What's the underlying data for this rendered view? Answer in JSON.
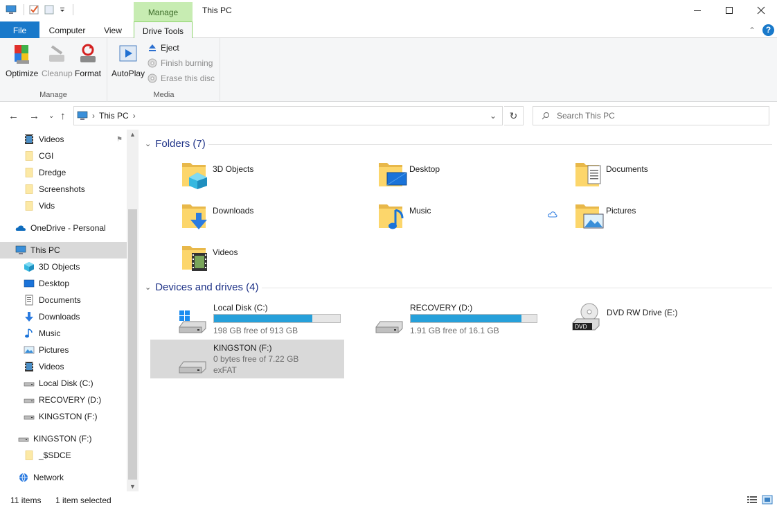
{
  "window": {
    "title": "This PC",
    "context_tab": "Manage"
  },
  "tabs": {
    "file": "File",
    "computer": "Computer",
    "view": "View",
    "drive_tools": "Drive Tools"
  },
  "ribbon": {
    "manage_group": {
      "label": "Manage",
      "optimize": "Optimize",
      "cleanup": "Cleanup",
      "format": "Format"
    },
    "media_group": {
      "label": "Media",
      "autoplay": "AutoPlay",
      "eject": "Eject",
      "finish_burning": "Finish burning",
      "erase_disc": "Erase this disc"
    }
  },
  "address": {
    "path": "This PC",
    "search_placeholder": "Search This PC"
  },
  "navpane": {
    "items": [
      {
        "label": "Videos",
        "icon": "videos-icon"
      },
      {
        "label": "CGI",
        "icon": "folder-icon"
      },
      {
        "label": "Dredge",
        "icon": "folder-icon"
      },
      {
        "label": "Screenshots",
        "icon": "folder-icon"
      },
      {
        "label": "Vids",
        "icon": "folder-icon"
      },
      {
        "label": "OneDrive - Personal",
        "icon": "onedrive-icon"
      },
      {
        "label": "This PC",
        "icon": "this-pc-icon"
      },
      {
        "label": "3D Objects",
        "icon": "3d-objects-icon"
      },
      {
        "label": "Desktop",
        "icon": "desktop-icon"
      },
      {
        "label": "Documents",
        "icon": "documents-icon"
      },
      {
        "label": "Downloads",
        "icon": "downloads-icon"
      },
      {
        "label": "Music",
        "icon": "music-icon"
      },
      {
        "label": "Pictures",
        "icon": "pictures-icon"
      },
      {
        "label": "Videos",
        "icon": "videos-icon"
      },
      {
        "label": "Local Disk (C:)",
        "icon": "drive-icon"
      },
      {
        "label": "RECOVERY (D:)",
        "icon": "drive-icon"
      },
      {
        "label": "KINGSTON (F:)",
        "icon": "drive-icon"
      },
      {
        "label": "KINGSTON (F:)",
        "icon": "drive-icon"
      },
      {
        "label": "_$SDCE",
        "icon": "folder-icon"
      },
      {
        "label": "Network",
        "icon": "network-icon"
      }
    ]
  },
  "content": {
    "folders_header": "Folders (7)",
    "folders": [
      {
        "name": "3D Objects",
        "icon": "3d-objects-icon"
      },
      {
        "name": "Desktop",
        "icon": "desktop-icon"
      },
      {
        "name": "Documents",
        "icon": "documents-icon"
      },
      {
        "name": "Downloads",
        "icon": "downloads-icon"
      },
      {
        "name": "Music",
        "icon": "music-icon"
      },
      {
        "name": "Pictures",
        "icon": "pictures-icon"
      },
      {
        "name": "Videos",
        "icon": "videos-icon"
      }
    ],
    "devices_header": "Devices and drives (4)",
    "drives": [
      {
        "name": "Local Disk (C:)",
        "free": "198 GB free of 913 GB",
        "used_fraction": 0.78
      },
      {
        "name": "RECOVERY (D:)",
        "free": "1.91 GB free of 16.1 GB",
        "used_fraction": 0.88
      },
      {
        "name": "DVD RW Drive (E:)"
      },
      {
        "name": "KINGSTON (F:)",
        "free": "0 bytes free of 7.22 GB",
        "fs": "exFAT"
      }
    ]
  },
  "status": {
    "items": "11 items",
    "selected": "1 item selected"
  },
  "colors": {
    "accent": "#1979ca",
    "bar_fill": "#26a0da",
    "context_tab": "#c7ecb2",
    "group_header": "#1e3287"
  }
}
